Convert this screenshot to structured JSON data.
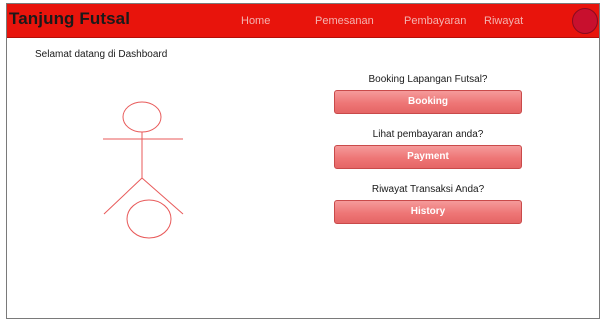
{
  "navbar": {
    "brand": "Tanjung Futsal",
    "links": [
      "Home",
      "Pemesanan",
      "Pembayaran",
      "Riwayat"
    ]
  },
  "main": {
    "welcome": "Selamat datang di Dashboard",
    "actions": [
      {
        "prompt": "Booking Lapangan Futsal?",
        "button": "Booking"
      },
      {
        "prompt": "Lihat pembayaran anda?",
        "button": "Payment"
      },
      {
        "prompt": "Riwayat Transaksi Anda?",
        "button": "History"
      }
    ]
  },
  "colors": {
    "navbar": "#e8140c",
    "button": "#ee7676",
    "figure_stroke": "#e85a5a",
    "avatar": "#c8102e"
  },
  "icons": {
    "illustration": "stick-figure-icon",
    "avatar": "user-avatar-icon"
  }
}
